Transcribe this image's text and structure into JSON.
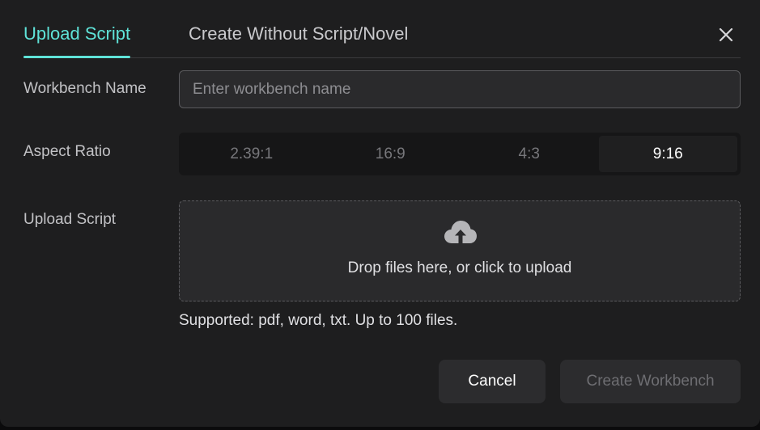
{
  "tabs": [
    {
      "label": "Upload Script",
      "active": true
    },
    {
      "label": "Create Without Script/Novel",
      "active": false
    }
  ],
  "close": {
    "icon": "close-icon"
  },
  "form": {
    "name_label": "Workbench Name",
    "name_placeholder": "Enter workbench name",
    "name_value": "",
    "aspect_label": "Aspect Ratio",
    "aspect_options": [
      "2.39:1",
      "16:9",
      "4:3",
      "9:16"
    ],
    "aspect_selected": "9:16",
    "upload_label": "Upload Script",
    "upload_icon": "cloud-upload-icon",
    "upload_text": "Drop files here, or click to upload",
    "upload_hint": "Supported: pdf, word, txt. Up to 100 files."
  },
  "actions": {
    "cancel_label": "Cancel",
    "create_label": "Create Workbench",
    "create_disabled": true
  },
  "colors": {
    "accent": "#5fe3d8",
    "background": "#1e1e1f",
    "input_bg": "#2a2a2c",
    "disabled_text": "#6e6e72"
  }
}
